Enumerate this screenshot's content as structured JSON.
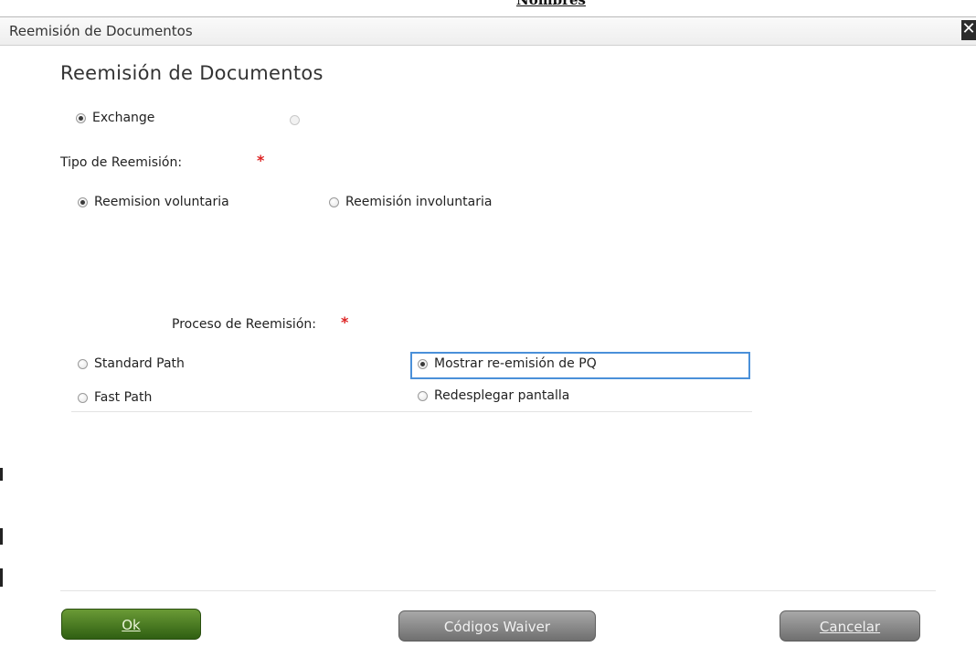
{
  "background_heading": "Nombres",
  "window": {
    "title": "Reemisión de Documentos",
    "close_glyph": "✕"
  },
  "heading": "Reemisión de Documentos",
  "mode_radios": [
    {
      "label": "Exchange",
      "selected": true
    }
  ],
  "tipo": {
    "label": "Tipo de Reemisión:",
    "required_mark": "*",
    "options": [
      {
        "label": "Reemision voluntaria",
        "selected": true
      },
      {
        "label": "Reemisión involuntaria",
        "selected": false
      }
    ]
  },
  "proceso": {
    "label": "Proceso de Reemisión:",
    "required_mark": "*",
    "path_options": [
      {
        "label": "Standard Path",
        "selected": false
      },
      {
        "label": "Fast Path",
        "selected": false
      }
    ],
    "display_options": [
      {
        "label": "Mostrar re-emisión de PQ",
        "selected": true
      },
      {
        "label": "Redesplegar pantalla",
        "selected": false
      }
    ]
  },
  "buttons": {
    "ok": "Ok",
    "waiver": "Códigos Waiver",
    "cancel": "Cancelar"
  },
  "colors": {
    "ok_button": "#3f7420",
    "grey_button": "#8c8c8c",
    "focus_border": "#4a90d9",
    "required": "#dd2222"
  }
}
